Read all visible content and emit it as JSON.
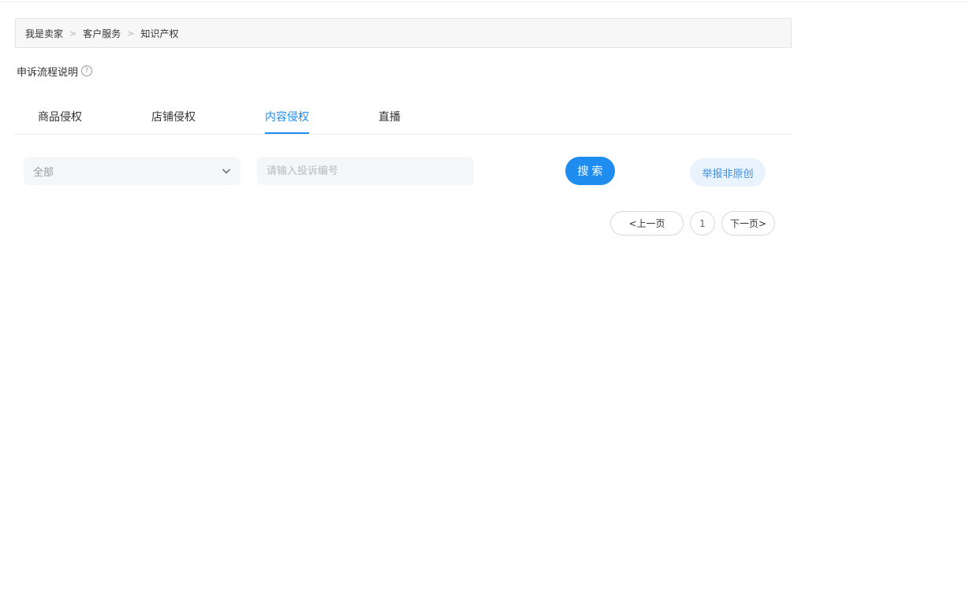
{
  "breadcrumb": {
    "items": [
      "我是卖家",
      "客户服务",
      "知识产权"
    ],
    "separator": ">"
  },
  "flow_help": {
    "label": "申诉流程说明",
    "icon": "question-circle-icon",
    "icon_glyph": "?"
  },
  "tabs": [
    {
      "label": "商品侵权",
      "active": false
    },
    {
      "label": "店铺侵权",
      "active": false
    },
    {
      "label": "内容侵权",
      "active": true
    },
    {
      "label": "直播",
      "active": false
    }
  ],
  "filters": {
    "select_value": "全部",
    "search_placeholder": "请输入投诉编号",
    "search_value": ""
  },
  "actions": {
    "search_label": "搜索",
    "report_label": "举报非原创"
  },
  "pagination": {
    "prev_label": "<上一页",
    "current_page": "1",
    "next_label": "下一页>"
  },
  "colors": {
    "accent": "#1f8cf0",
    "report_bg": "#e8f3fe",
    "report_text": "#3d8fe0"
  }
}
